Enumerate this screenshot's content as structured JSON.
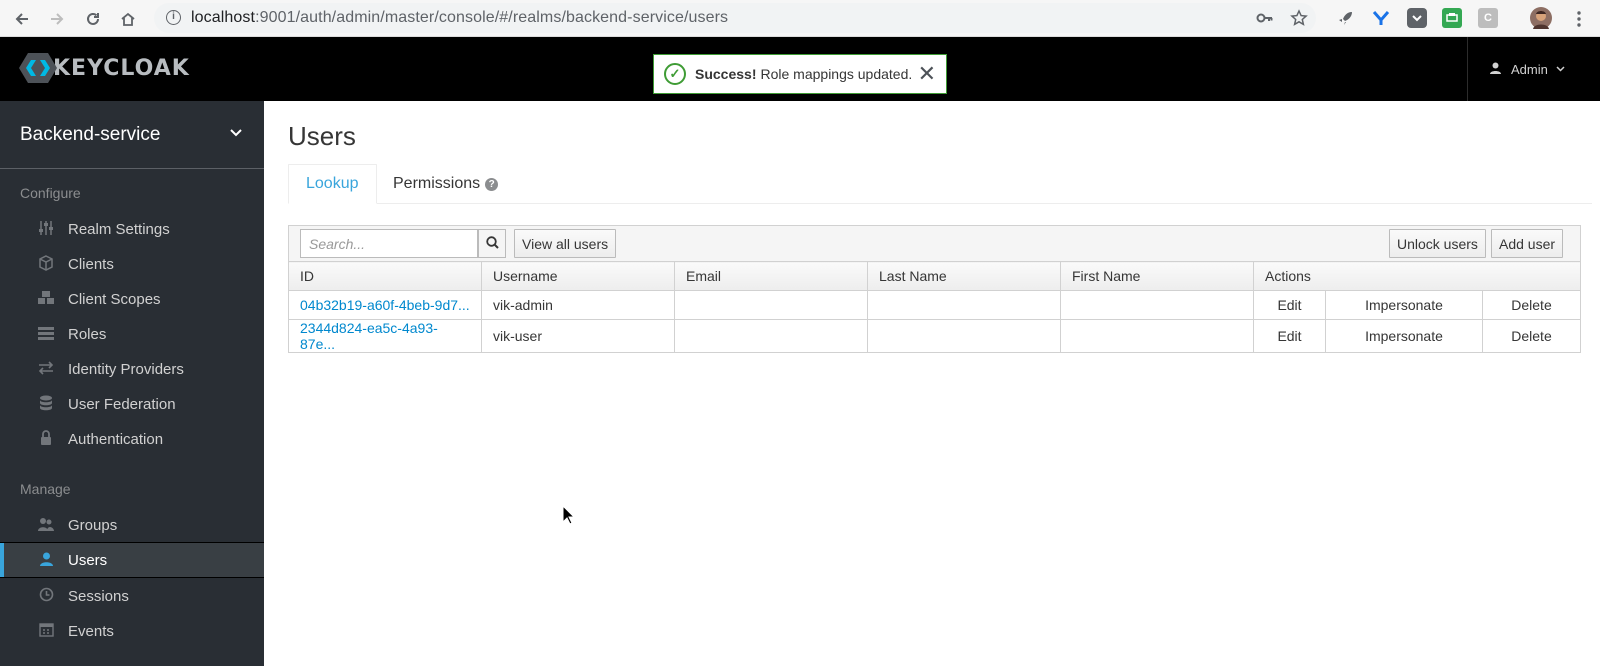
{
  "browser": {
    "url_host": "localhost",
    "url_path": ":9001/auth/admin/master/console/#/realms/backend-service/users",
    "extensions": [
      {
        "name": "rocket-extension-icon",
        "color": "#5f6368",
        "glyph": "🚀"
      },
      {
        "name": "y-extension-icon",
        "color": "#1a73e8",
        "glyph": "Y"
      },
      {
        "name": "pocket-extension-icon",
        "color": "#5f6368",
        "glyph": "◘"
      },
      {
        "name": "print-extension-icon",
        "color": "#34a853",
        "glyph": "▤"
      },
      {
        "name": "c-extension-icon",
        "color": "#bdbdbd",
        "glyph": "C"
      }
    ]
  },
  "header": {
    "logo_text": "KEYCLOAK",
    "alert": {
      "strong": "Success!",
      "message": "Role mappings updated."
    },
    "user_label": "Admin"
  },
  "sidebar": {
    "realm": "Backend-service",
    "configure_label": "Configure",
    "configure_items": [
      {
        "label": "Realm Settings",
        "icon": "sliders-icon"
      },
      {
        "label": "Clients",
        "icon": "cube-icon"
      },
      {
        "label": "Client Scopes",
        "icon": "cubes-icon"
      },
      {
        "label": "Roles",
        "icon": "list-icon"
      },
      {
        "label": "Identity Providers",
        "icon": "exchange-icon"
      },
      {
        "label": "User Federation",
        "icon": "database-icon"
      },
      {
        "label": "Authentication",
        "icon": "lock-icon"
      }
    ],
    "manage_label": "Manage",
    "manage_items": [
      {
        "label": "Groups",
        "icon": "users-icon"
      },
      {
        "label": "Users",
        "icon": "user-icon",
        "active": true
      },
      {
        "label": "Sessions",
        "icon": "clock-icon"
      },
      {
        "label": "Events",
        "icon": "calendar-icon"
      }
    ]
  },
  "main": {
    "title": "Users",
    "tabs": [
      {
        "label": "Lookup",
        "active": true
      },
      {
        "label": "Permissions",
        "help": "?"
      }
    ],
    "search_placeholder": "Search...",
    "view_all_label": "View all users",
    "unlock_label": "Unlock users",
    "add_user_label": "Add user",
    "columns": [
      "ID",
      "Username",
      "Email",
      "Last Name",
      "First Name",
      "Actions"
    ],
    "rows": [
      {
        "id": "04b32b19-a60f-4beb-9d7...",
        "username": "vik-admin",
        "email": "",
        "last_name": "",
        "first_name": ""
      },
      {
        "id": "2344d824-ea5c-4a93-87e...",
        "username": "vik-user",
        "email": "",
        "last_name": "",
        "first_name": ""
      }
    ],
    "actions": {
      "edit": "Edit",
      "impersonate": "Impersonate",
      "delete": "Delete"
    }
  },
  "colors": {
    "accent": "#39a5dc",
    "link": "#0088ce",
    "sidebar_bg": "#292e34",
    "success": "#3f9c35"
  }
}
